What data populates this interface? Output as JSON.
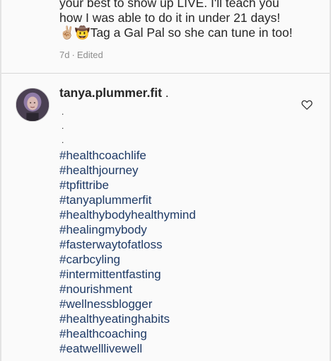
{
  "post": {
    "caption_lines": [
      "your best to show up LIVE. I'll teach you",
      "how I was able to do it in under 21 days!",
      "✌🏼🤠Tag a Gal Pal so she can tune in too!"
    ],
    "age": "7d",
    "separator": "·",
    "edited_label": "Edited"
  },
  "comment": {
    "username": "tanya.plummer.fit",
    "username_trail": " .",
    "dot_lines": [
      ".",
      ".",
      "."
    ],
    "hashtags": [
      "#healthcoachlife",
      "#healthjourney",
      "#tpfittribe",
      "#tanyaplummerfit",
      "#healthybodyhealthymind",
      "#healingmybody",
      "#fasterwaytofatloss",
      "#carbcyling",
      "#intermittentfasting",
      "#nourishment",
      "#wellnessblogger",
      "#healthyeatinghabits",
      "#healthcoaching",
      "#eatwelllivewell"
    ],
    "like_icon": "heart-outline-icon"
  },
  "colors": {
    "hashtag": "#1e3a66",
    "meta_text": "#8e8e8e",
    "divider": "#d8d8d8",
    "background": "#fafafa"
  }
}
